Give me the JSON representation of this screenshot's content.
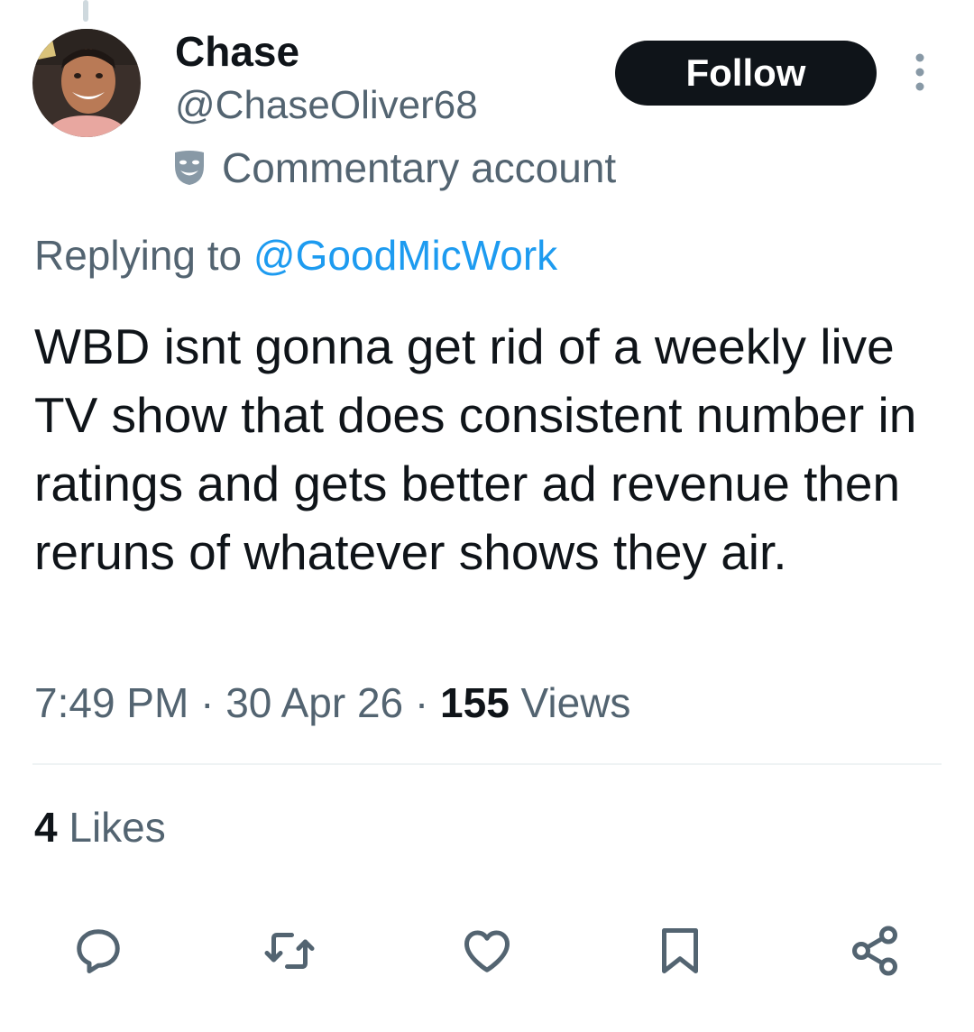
{
  "author": {
    "display_name": "Chase",
    "handle": "@ChaseOliver68",
    "label": "Commentary account",
    "label_icon": "comedy-mask-icon",
    "avatar": "profile-photo"
  },
  "follow_button": {
    "label": "Follow"
  },
  "more_menu": {
    "icon": "more-vertical-icon"
  },
  "reply_context": {
    "prefix": "Replying to ",
    "mention": "@GoodMicWork"
  },
  "tweet": {
    "text": "WBD isnt gonna get rid of a weekly live TV show that does consistent number in ratings and gets better ad revenue then reruns of whatever shows they air."
  },
  "meta": {
    "time": "7:49 PM",
    "separator": " · ",
    "date": "30 Apr 26",
    "views_count": "155",
    "views_label": " Views"
  },
  "stats": {
    "likes_count": "4",
    "likes_label": " Likes"
  },
  "actions": [
    {
      "icon": "reply-icon"
    },
    {
      "icon": "retweet-icon"
    },
    {
      "icon": "like-icon"
    },
    {
      "icon": "bookmark-icon"
    },
    {
      "icon": "share-icon"
    }
  ],
  "colors": {
    "text_primary": "#0f1419",
    "text_secondary": "#536471",
    "link": "#1d9bf0",
    "follow_bg": "#0f1419",
    "divider": "#eff3f4"
  }
}
